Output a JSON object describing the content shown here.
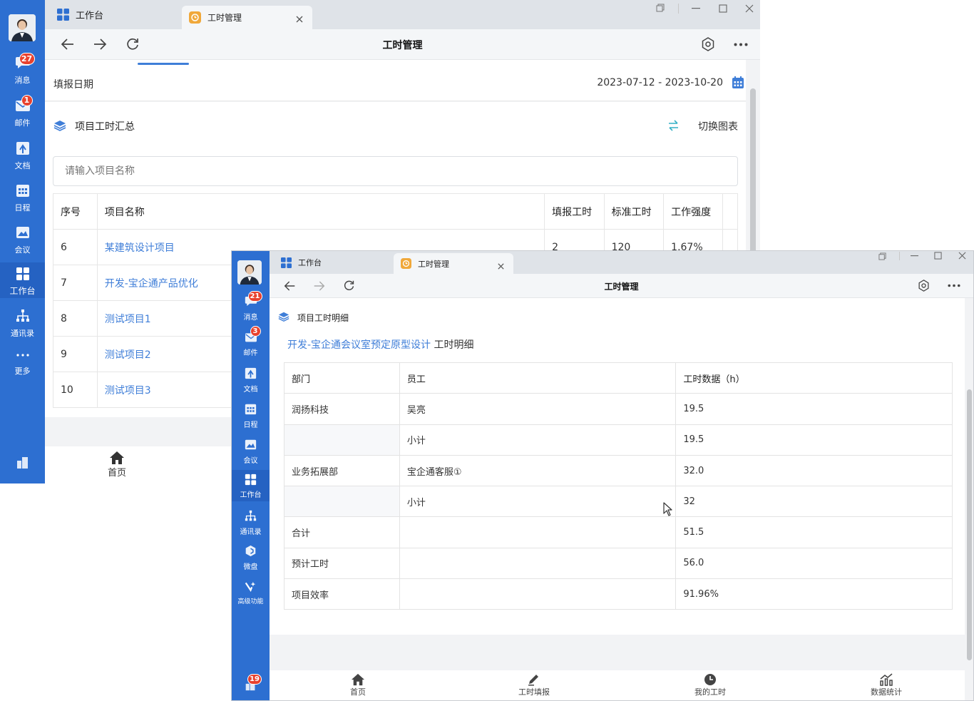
{
  "colors": {
    "brand": "#2d6fd1",
    "link": "#3f7ed8",
    "badge": "#e8412e",
    "tab_icon_workbench": "#2d6fd1",
    "tab_icon_timesheet": "#f0a83a"
  },
  "back_window": {
    "sidebar": {
      "items": [
        {
          "label": "消息",
          "icon": "chat-icon",
          "badge": "27"
        },
        {
          "label": "邮件",
          "icon": "mail-icon",
          "badge": "1"
        },
        {
          "label": "文档",
          "icon": "document-icon"
        },
        {
          "label": "日程",
          "icon": "calendar-icon"
        },
        {
          "label": "会议",
          "icon": "meeting-icon"
        },
        {
          "label": "工作台",
          "icon": "grid-icon"
        },
        {
          "label": "通讯录",
          "icon": "org-chart-icon"
        },
        {
          "label": "更多",
          "icon": "more-icon"
        }
      ]
    },
    "tabs": [
      {
        "label": "工作台"
      },
      {
        "label": "工时管理"
      }
    ],
    "toolbar_title": "工时管理",
    "date_label": "填报日期",
    "date_range": "2023-07-12 - 2023-10-20",
    "section_title": "项目工时汇总",
    "switch_chart": "切换图表",
    "search_placeholder": "请输入项目名称",
    "table": {
      "headers": [
        "序号",
        "项目名称",
        "填报工时",
        "标准工时",
        "工作强度"
      ],
      "rows": [
        {
          "no": "6",
          "name": "某建筑设计项目",
          "filled": "2",
          "standard": "120",
          "intensity": "1.67%"
        },
        {
          "no": "7",
          "name": "开发-宝企通产品优化"
        },
        {
          "no": "8",
          "name": "测试项目1"
        },
        {
          "no": "9",
          "name": "测试项目2"
        },
        {
          "no": "10",
          "name": "测试项目3"
        }
      ]
    },
    "bottom_nav": {
      "home": "首页"
    }
  },
  "front_window": {
    "sidebar": {
      "items": [
        {
          "label": "消息",
          "icon": "chat-icon",
          "badge": "21"
        },
        {
          "label": "邮件",
          "icon": "mail-icon",
          "badge": "3"
        },
        {
          "label": "文档",
          "icon": "document-icon"
        },
        {
          "label": "日程",
          "icon": "calendar-icon"
        },
        {
          "label": "会议",
          "icon": "meeting-icon"
        },
        {
          "label": "工作台",
          "icon": "grid-icon"
        },
        {
          "label": "通讯录",
          "icon": "org-chart-icon"
        },
        {
          "label": "微盘",
          "icon": "cloud-disk-icon"
        },
        {
          "label": "高级功能",
          "icon": "advanced-icon"
        }
      ],
      "bottom_badge": "19"
    },
    "tabs": [
      {
        "label": "工作台"
      },
      {
        "label": "工时管理"
      }
    ],
    "toolbar_title": "工时管理",
    "section_title": "项目工时明细",
    "project_link": "开发-宝企通会议室预定原型设计",
    "project_suffix": "工时明细",
    "table": {
      "headers": [
        "部门",
        "员工",
        "工时数据（h）"
      ],
      "rows": [
        [
          "润扬科技",
          "吴亮",
          "19.5"
        ],
        [
          "",
          "小计",
          "19.5"
        ],
        [
          "业务拓展部",
          "宝企通客服①",
          "32.0"
        ],
        [
          "",
          "小计",
          "32"
        ],
        [
          "合计",
          "",
          "51.5"
        ],
        [
          "预计工时",
          "",
          "56.0"
        ],
        [
          "项目效率",
          "",
          "91.96%"
        ]
      ]
    },
    "bottom_nav": [
      "首页",
      "工时填报",
      "我的工时",
      "数据统计"
    ]
  }
}
